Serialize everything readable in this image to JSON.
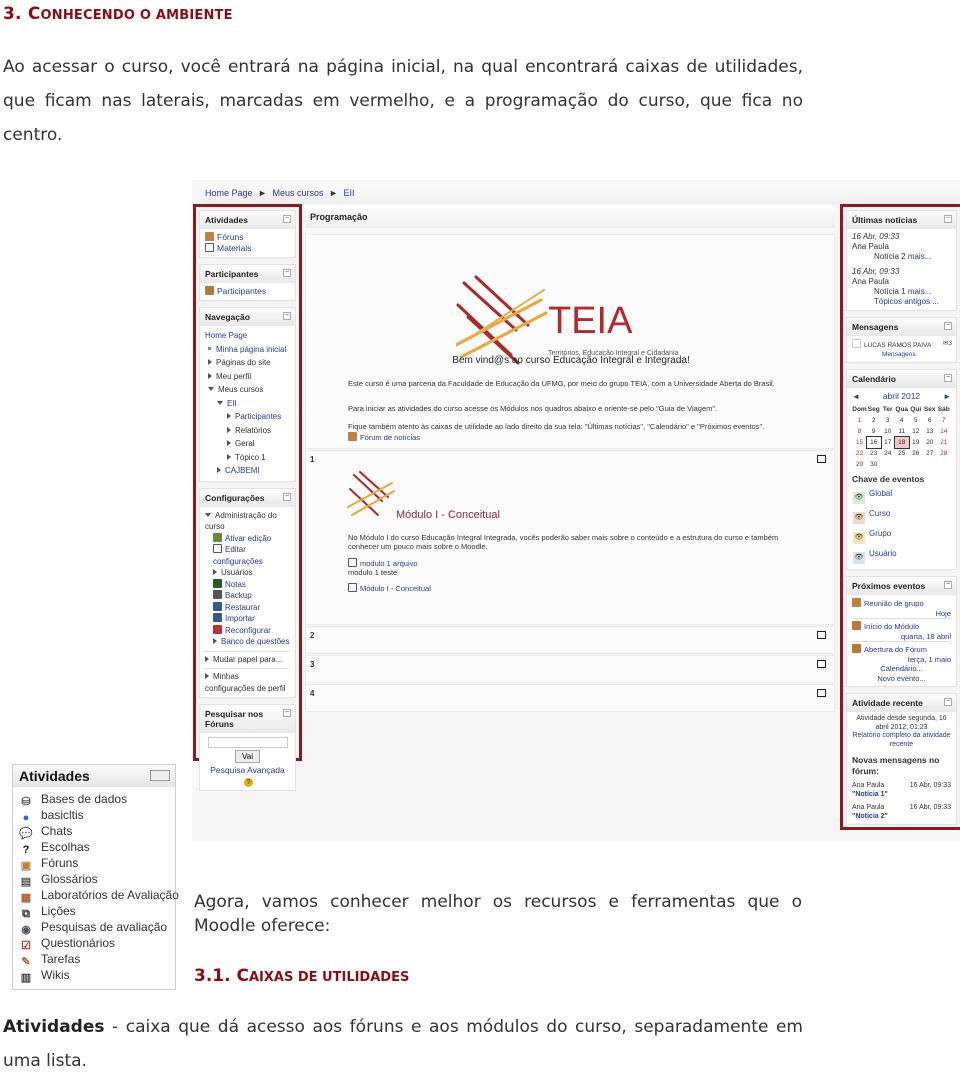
{
  "heading": {
    "number": "3.",
    "first_letter": "C",
    "rest": "ONHECENDO O AMBIENTE"
  },
  "intro": "Ao acessar o curso, você entrará na página inicial, na qual encontrará caixas de utilidades, que ficam nas laterais, marcadas em vermelho, e a programação do curso, que fica no centro.",
  "screenshot": {
    "breadcrumb": [
      "Home Page",
      "►",
      "Meus cursos",
      "►",
      "EII"
    ],
    "left": {
      "atividades": {
        "title": "Atividades",
        "items": [
          "Fóruns",
          "Materiais"
        ]
      },
      "participantes": {
        "title": "Participantes",
        "items": [
          "Participantes"
        ]
      },
      "navegacao": {
        "title": "Navegação",
        "home": "Home Page",
        "items": [
          "Minha página inicial",
          "Páginas do site",
          "Meu perfil",
          "Meus cursos",
          "EII",
          "Participantes",
          "Relatórios",
          "Geral",
          "Tópico 1",
          "CAJBEMI"
        ]
      },
      "config": {
        "title": "Configurações",
        "admin": "Administração do curso",
        "items": [
          "Ativar edição",
          "Editar configurações",
          "Usuários",
          "Notas",
          "Backup",
          "Restaurar",
          "Importar",
          "Reconfigurar",
          "Banco de questões"
        ],
        "mudar": "Mudar papel para...",
        "minhas": "Minhas configurações de perfil"
      },
      "search": {
        "title": "Pesquisar nos Fóruns",
        "input_value": "",
        "button": "Vai",
        "advanced": "Pesquisa Avançada"
      }
    },
    "center": {
      "title": "Programação",
      "logo": {
        "word": "TEIA",
        "tagline": "Territórios, Educação Integral e Cidadania"
      },
      "welcome": "Bem vind@s ao curso Educação Integral e Integrada!",
      "p1": "Este curso é uma parceria da Faculdade de Educação da UFMG, por meio do grupo TEIA, com a Universidade Aberta do Brasil.",
      "p2": "Para iniciar as atividades do curso acesse os Módulos nos quadros abaixo e oriente-se pelo \"Guia de Viagem\".",
      "p3": "Fique também atento às caixas de utilidade ao lado direito da sua tela: \"Últimas notícias\", \"Calendário\" e \"Próximos eventos\".",
      "forum_link": "Fórum de notícias",
      "sections": [
        {
          "num": "1",
          "module_title": "Módulo I - Conceitual",
          "desc": "No Módulo I do curso Educação Integral Integrada, vocês poderão saber mais sobre o conteúdo e a estrutura do curso e também conhecer um pouco mais sobre o Moodle.",
          "res1": "modulo 1 arquivo",
          "res1_desc": "modulo 1 teste",
          "res2": "Módulo I - Conceitual"
        },
        {
          "num": "2"
        },
        {
          "num": "3"
        },
        {
          "num": "4"
        }
      ]
    },
    "right": {
      "news": {
        "title": "Últimas notícias",
        "items": [
          {
            "date": "16 Abr, 09:33",
            "author": "Ana Paula",
            "subject": "Notícia 2",
            "more": "mais..."
          },
          {
            "date": "16 Abr, 09:33",
            "author": "Ana Paula",
            "subject": "Notícia 1",
            "more": "mais..."
          }
        ],
        "older": "Tópicos antigos ..."
      },
      "messages": {
        "title": "Mensagens",
        "user": "LUCAS RAMOS PAIVA",
        "count": "3",
        "link": "Mensagens"
      },
      "calendar": {
        "title": "Calendário",
        "month": "abril 2012",
        "days": [
          "Dom",
          "Seg",
          "Ter",
          "Qua",
          "Qui",
          "Sex",
          "Sáb"
        ],
        "weeks": [
          [
            "1",
            "2",
            "3",
            "4",
            "5",
            "6",
            "7"
          ],
          [
            "8",
            "9",
            "10",
            "11",
            "12",
            "13",
            "14"
          ],
          [
            "15",
            "16",
            "17",
            "18",
            "19",
            "20",
            "21"
          ],
          [
            "22",
            "23",
            "24",
            "25",
            "26",
            "27",
            "28"
          ],
          [
            "29",
            "30",
            "",
            "",
            "",
            "",
            ""
          ]
        ],
        "marked": "16",
        "today": "18",
        "key_title": "Chave de eventos",
        "keys": [
          {
            "label": "Global",
            "color": "#d4f0d4"
          },
          {
            "label": "Curso",
            "color": "#f8d8c8"
          },
          {
            "label": "Grupo",
            "color": "#f8e8b0"
          },
          {
            "label": "Usuário",
            "color": "#d8e4ec"
          }
        ]
      },
      "events": {
        "title": "Próximos eventos",
        "items": [
          {
            "name": "Reunião de grupo",
            "when": "Hoje"
          },
          {
            "name": "Início do Módulo",
            "when": "quarta, 18 abril"
          },
          {
            "name": "Abertura do Fórum",
            "when": "terça, 1 maio"
          }
        ],
        "calendar_link": "Calendário...",
        "new_event": "Novo evento..."
      },
      "recent": {
        "title": "Atividade recente",
        "since": "Atividade desde segunda, 16 abril 2012, 01:23",
        "report": "Relatório completo da atividade recente",
        "new_posts": "Novas mensagens no fórum:",
        "posts": [
          {
            "author": "Ana Paula",
            "date": "16 Abr, 09:33",
            "title": "\"Notícia 1\""
          },
          {
            "author": "Ana Paula",
            "date": "16 Abr, 09:33",
            "title": "\"Notícia 2\""
          }
        ]
      }
    }
  },
  "activities_widget": {
    "title": "Atividades",
    "items": [
      {
        "label": "Bases de dados",
        "icon": "database-icon"
      },
      {
        "label": "basicltis",
        "icon": "globe-icon"
      },
      {
        "label": "Chats",
        "icon": "chat-icon"
      },
      {
        "label": "Escolhas",
        "icon": "question-icon"
      },
      {
        "label": "Fóruns",
        "icon": "forum-icon"
      },
      {
        "label": "Glossários",
        "icon": "glossary-icon"
      },
      {
        "label": "Laboratórios de Avaliação",
        "icon": "workshop-icon"
      },
      {
        "label": "Lições",
        "icon": "lesson-icon"
      },
      {
        "label": "Pesquisas de avaliação",
        "icon": "survey-icon"
      },
      {
        "label": "Questionários",
        "icon": "quiz-icon"
      },
      {
        "label": "Tarefas",
        "icon": "assignment-icon"
      },
      {
        "label": "Wikis",
        "icon": "wiki-icon"
      }
    ]
  },
  "para2": "Agora, vamos conhecer melhor os recursos e ferramentas que o Moodle oferece:",
  "heading2": {
    "number": "3.1.",
    "first_letter": "C",
    "rest": "AIXAS DE UTILIDADES"
  },
  "para3": {
    "bold": "Atividades",
    "rest": " - caixa que dá acesso aos fóruns e aos módulos do curso, separadamente em uma lista."
  }
}
